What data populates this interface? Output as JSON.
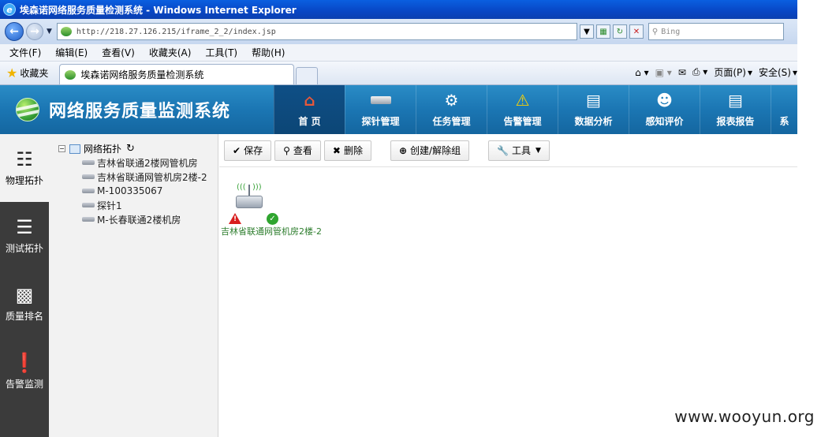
{
  "window": {
    "title": "埃森诺网络服务质量检测系统 - Windows Internet Explorer"
  },
  "address": {
    "url": "http://218.27.126.215/iframe_2_2/index.jsp",
    "search_placeholder": "Bing"
  },
  "menu": [
    "文件(F)",
    "编辑(E)",
    "查看(V)",
    "收藏夹(A)",
    "工具(T)",
    "帮助(H)"
  ],
  "favorites": {
    "label": "收藏夹",
    "tab_title": "埃森诺网络服务质量检测系统"
  },
  "command_bar": {
    "page": "页面(P)",
    "safety": "安全(S)"
  },
  "app": {
    "title": "网络服务质量监测系统",
    "nav": [
      {
        "label": "首 页",
        "icon": "house-icon"
      },
      {
        "label": "探针管理",
        "icon": "probe-device-icon"
      },
      {
        "label": "任务管理",
        "icon": "task-gear-icon"
      },
      {
        "label": "告警管理",
        "icon": "warning-icon"
      },
      {
        "label": "数据分析",
        "icon": "chart-icon"
      },
      {
        "label": "感知评价",
        "icon": "user-evaluation-icon"
      },
      {
        "label": "报表报告",
        "icon": "report-icon"
      },
      {
        "label": "系",
        "icon": "system-icon"
      }
    ]
  },
  "sidebar": [
    {
      "label": "物理拓扑",
      "icon": "topology-icon"
    },
    {
      "label": "测试拓扑",
      "icon": "list-topology-icon"
    },
    {
      "label": "质量排名",
      "icon": "bar-chart-icon"
    },
    {
      "label": "告警监测",
      "icon": "alert-icon"
    }
  ],
  "tree": {
    "root": "网络拓扑",
    "nodes": [
      "吉林省联通2楼网管机房",
      "吉林省联通网管机房2楼-2",
      "M-100335067",
      "探针1",
      "M-长春联通2楼机房"
    ]
  },
  "toolbar": {
    "save": "保存",
    "view": "查看",
    "delete": "删除",
    "group": "创建/解除组",
    "tools": "工具"
  },
  "canvas": {
    "device_label": "吉林省联通网管机房2楼-2"
  },
  "watermark": "www.wooyun.org"
}
